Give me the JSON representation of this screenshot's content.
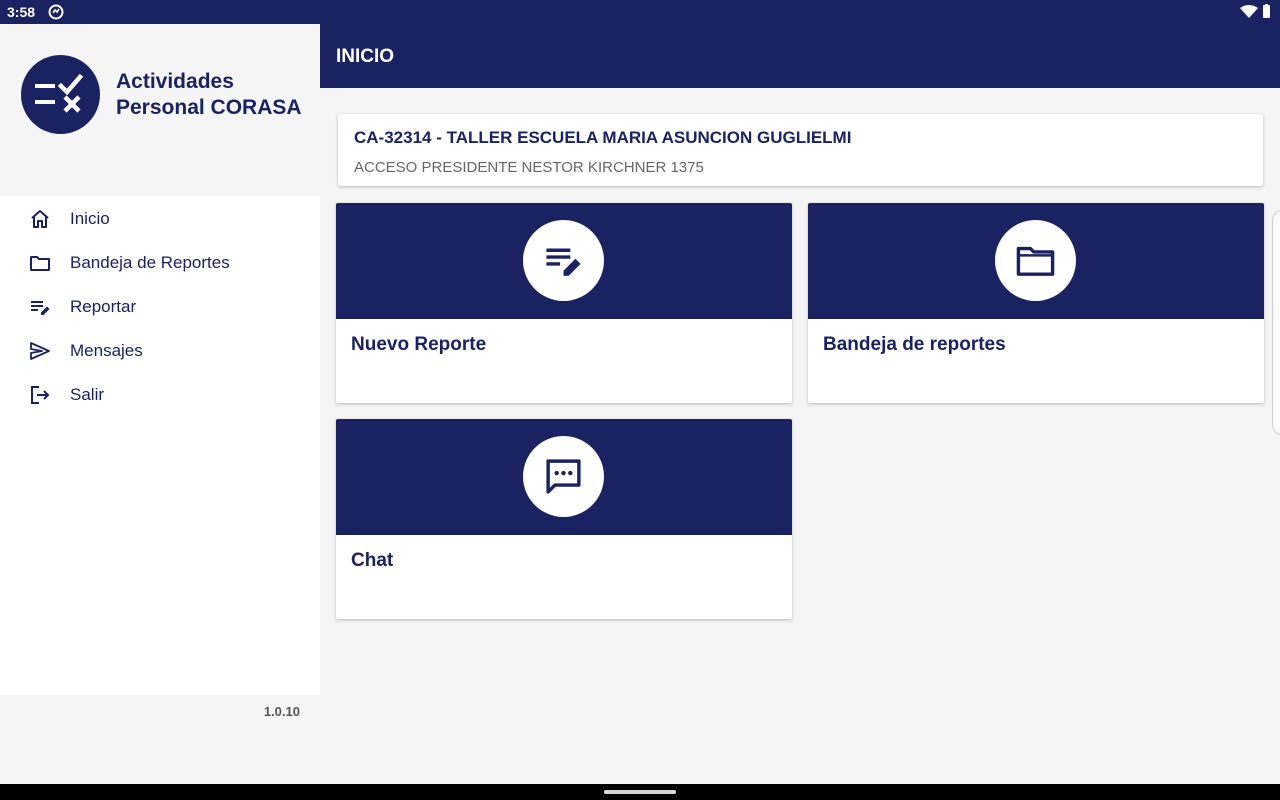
{
  "status_bar": {
    "time": "3:58"
  },
  "sidebar": {
    "app_title_line1": "Actividades",
    "app_title_line2": "Personal CORASA",
    "items": [
      {
        "label": "Inicio",
        "icon": "home-icon"
      },
      {
        "label": "Bandeja de Reportes",
        "icon": "folder-icon"
      },
      {
        "label": "Reportar",
        "icon": "edit-list-icon"
      },
      {
        "label": "Mensajes",
        "icon": "send-icon"
      },
      {
        "label": "Salir",
        "icon": "logout-icon"
      }
    ],
    "version": "1.0.10"
  },
  "app_bar": {
    "title": "INICIO"
  },
  "school": {
    "name": "CA-32314 - TALLER ESCUELA MARIA ASUNCION GUGLIELMI",
    "address": "ACCESO PRESIDENTE NESTOR KIRCHNER 1375"
  },
  "tiles": [
    {
      "label": "Nuevo Reporte",
      "icon": "edit-note-icon"
    },
    {
      "label": "Bandeja de reportes",
      "icon": "folder-icon"
    },
    {
      "label": "Chat",
      "icon": "chat-icon"
    }
  ],
  "colors": {
    "primary": "#1b2262",
    "background": "#f5f5f5",
    "surface": "#ffffff"
  }
}
